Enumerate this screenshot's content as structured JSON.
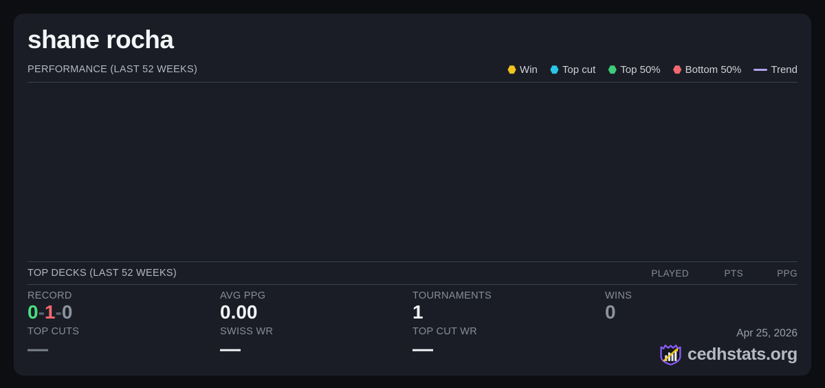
{
  "player": {
    "name": "shane rocha"
  },
  "performance": {
    "title": "PERFORMANCE (LAST 52 WEEKS)",
    "legend": [
      {
        "label": "Win",
        "color": "#f0c31e",
        "marker": "hexagon"
      },
      {
        "label": "Top cut",
        "color": "#29c5e8",
        "marker": "hexagon"
      },
      {
        "label": "Top 50%",
        "color": "#3ecb7a",
        "marker": "hexagon"
      },
      {
        "label": "Bottom 50%",
        "color": "#f1696e",
        "marker": "hexagon"
      },
      {
        "label": "Trend",
        "color": "#b1a2f1",
        "marker": "line"
      }
    ],
    "chart_empty": true
  },
  "top_decks": {
    "title": "TOP DECKS (LAST 52 WEEKS)",
    "columns": [
      "PLAYED",
      "PTS",
      "PPG"
    ],
    "rows": []
  },
  "stats": {
    "record": {
      "label": "RECORD",
      "wins": "0",
      "losses": "1",
      "draws": "0",
      "separator": "-"
    },
    "avg_ppg": {
      "label": "AVG PPG",
      "value": "0.00"
    },
    "tournaments": {
      "label": "TOURNAMENTS",
      "value": "1"
    },
    "wins": {
      "label": "WINS",
      "value": "0"
    },
    "top_cuts": {
      "label": "TOP CUTS",
      "value": "—"
    },
    "swiss_wr": {
      "label": "SWISS WR",
      "value": "—"
    },
    "top_cut_wr": {
      "label": "TOP CUT WR",
      "value": "—"
    }
  },
  "footer": {
    "date": "Apr 25, 2026",
    "brand": "cedhstats.org"
  },
  "colors": {
    "background": "#0c0e12",
    "card": "#1a1d25",
    "divider": "#3b4150",
    "win_green": "#4ade80",
    "loss_red": "#f4696f",
    "muted_gray": "#8b919e",
    "brand_purple": "#8b5cf6",
    "arrow_gold": "#f2c218"
  }
}
